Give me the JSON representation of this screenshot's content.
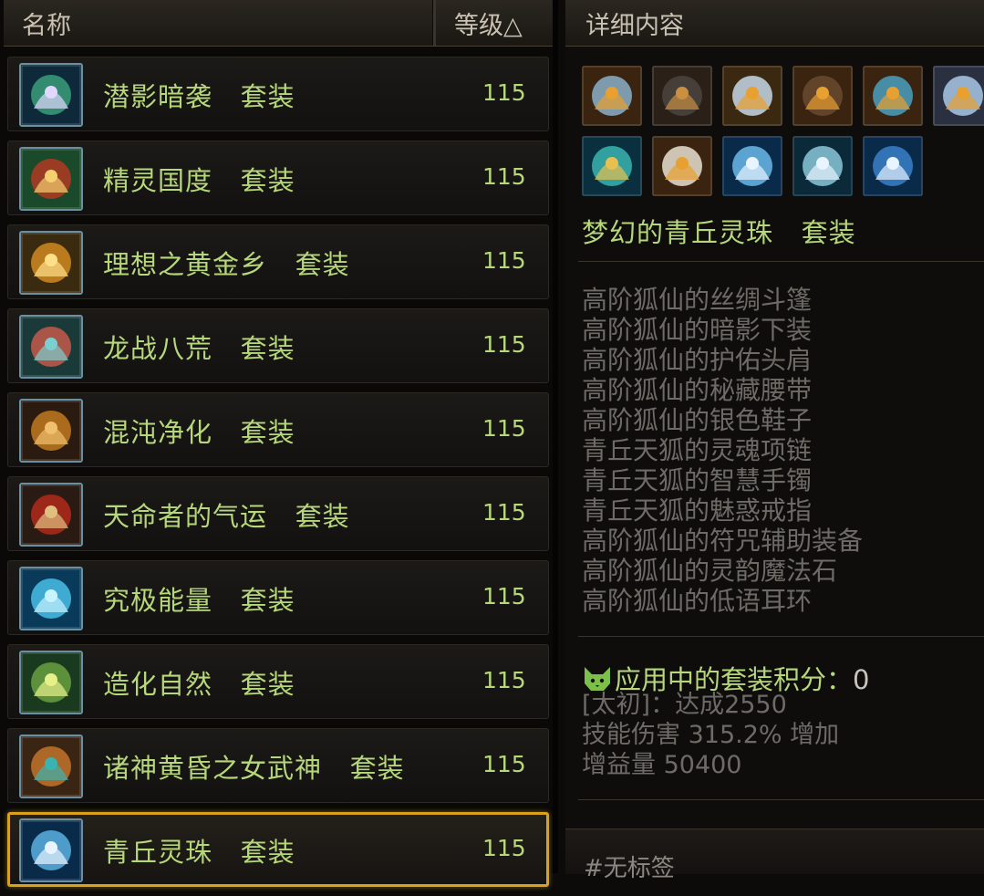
{
  "list_header": {
    "name_label": "名称",
    "level_label": "等级△"
  },
  "sets": [
    {
      "name": "潜影暗袭   套装",
      "level": "115",
      "icon": "shadow-tree-icon",
      "colors": [
        "#0e2a3a",
        "#3a9c7a",
        "#e0d8ff"
      ]
    },
    {
      "name": "精灵国度   套装",
      "level": "115",
      "icon": "red-flower-icon",
      "colors": [
        "#1a4a2a",
        "#b23a22",
        "#f4d070"
      ]
    },
    {
      "name": "理想之黄金乡   套装",
      "level": "115",
      "icon": "golden-orb-icon",
      "colors": [
        "#3a2a10",
        "#d08a20",
        "#ffe08a"
      ]
    },
    {
      "name": "龙战八荒   套装",
      "level": "115",
      "icon": "dragon-claw-icon",
      "colors": [
        "#1a3a3a",
        "#c45a4a",
        "#7acfcf"
      ]
    },
    {
      "name": "混沌净化   套装",
      "level": "115",
      "icon": "maple-leaf-icon",
      "colors": [
        "#2a1a10",
        "#c27a20",
        "#f0c070"
      ]
    },
    {
      "name": "天命者的气运   套装",
      "level": "115",
      "icon": "fate-scroll-icon",
      "colors": [
        "#2a1a14",
        "#b22a1a",
        "#e0c080"
      ]
    },
    {
      "name": "究极能量   套装",
      "level": "115",
      "icon": "energy-crystal-icon",
      "colors": [
        "#0a3a5a",
        "#4ac0e8",
        "#c8f4ff"
      ]
    },
    {
      "name": "造化自然   套装",
      "level": "115",
      "icon": "nature-seed-icon",
      "colors": [
        "#1a3a20",
        "#6aa040",
        "#e8f08a"
      ]
    },
    {
      "name": "诸神黄昏之女武神   套装",
      "level": "115",
      "icon": "valkyrie-wing-icon",
      "colors": [
        "#3a2414",
        "#c2742a",
        "#3ab4b0"
      ]
    },
    {
      "name": "青丘灵珠   套装",
      "level": "115",
      "icon": "spirit-orb-icon",
      "colors": [
        "#0a2a4a",
        "#5ab0e0",
        "#e8f4ff"
      ]
    }
  ],
  "selected_index": 9,
  "detail": {
    "header": "详细内容",
    "piece_icons": [
      {
        "icon": "cloak-icon",
        "colors": [
          "#3a2410",
          "#8ab0c8",
          "#e8a030"
        ]
      },
      {
        "icon": "dark-pants-icon",
        "colors": [
          "#2a2018",
          "#4a4440",
          "#c89040"
        ]
      },
      {
        "icon": "shoulder-armor-icon",
        "colors": [
          "#3a2810",
          "#c8d8e8",
          "#e8a030"
        ]
      },
      {
        "icon": "belt-icon",
        "colors": [
          "#3a2410",
          "#6a4a30",
          "#e8a030"
        ]
      },
      {
        "icon": "boots-icon",
        "colors": [
          "#3a2410",
          "#4aa0c0",
          "#e8a030"
        ]
      },
      {
        "icon": "necklace-icon",
        "colors": [
          "#2a3040",
          "#a8c8e8",
          "#e8a030"
        ]
      },
      {
        "icon": "bracelet-icon",
        "colors": [
          "#0a3040",
          "#3ab4b0",
          "#e8c050"
        ]
      },
      {
        "icon": "fox-ring-icon",
        "colors": [
          "#3a2410",
          "#e8e0d0",
          "#e8a030"
        ]
      },
      {
        "icon": "talisman-icon",
        "colors": [
          "#0a2a4a",
          "#6ab8e8",
          "#e8f4ff"
        ]
      },
      {
        "icon": "magic-stone-icon",
        "colors": [
          "#0a2a3a",
          "#8ac8d8",
          "#e8f4ff"
        ]
      },
      {
        "icon": "earring-icon",
        "colors": [
          "#0a2a4a",
          "#3a80c8",
          "#e8f4ff"
        ]
      }
    ],
    "set_title": "梦幻的青丘灵珠   套装",
    "pieces": [
      "高阶狐仙的丝绸斗篷",
      "高阶狐仙的暗影下装",
      "高阶狐仙的护佑头肩",
      "高阶狐仙的秘藏腰带",
      "高阶狐仙的银色鞋子",
      "青丘天狐的灵魂项链",
      "青丘天狐的智慧手镯",
      "青丘天狐的魅惑戒指",
      "高阶狐仙的符咒辅助装备",
      "高阶狐仙的灵韵魔法石",
      "高阶狐仙的低语耳环"
    ],
    "score_label": "应用中的套装积分：",
    "score_value": "0",
    "bonus": [
      "[太初]：达成2550",
      "技能伤害 315.2% 增加",
      "增益量 50400"
    ],
    "tag": "#无标签"
  }
}
